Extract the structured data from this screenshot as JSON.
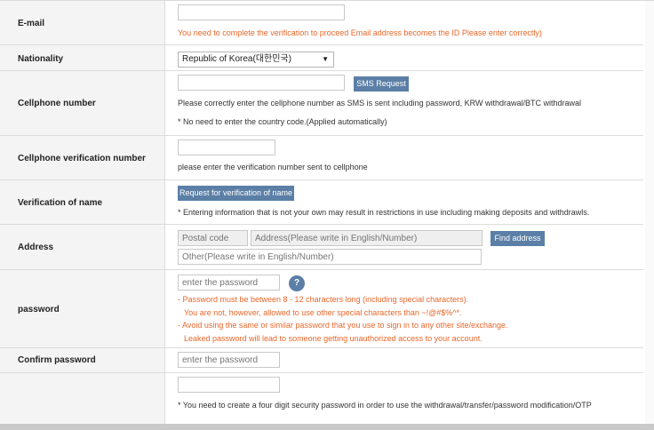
{
  "rows": {
    "email": {
      "label": "E-mail",
      "value": "",
      "hint": "You need to complete the verification to proceed Email address becomes the ID Please enter correctly)"
    },
    "nationality": {
      "label": "Nationality",
      "selected": "Republic of Korea(대한민국)"
    },
    "cellphone": {
      "label": "Cellphone number",
      "value": "",
      "button": "SMS Request",
      "hint1": "Please correctly enter the cellphone number as SMS is sent including password, KRW withdrawal/BTC withdrawal",
      "hint2": "* No need to enter the country code.(Applied automatically)"
    },
    "verification": {
      "label": "Cellphone verification number",
      "value": "",
      "hint": "please enter the verification number sent to cellphone"
    },
    "name": {
      "label": "Verification of name",
      "button": "Request for verification of name",
      "hint": "* Entering information that is not your own may result in restrictions in use including making deposits and withdrawls."
    },
    "address": {
      "label": "Address",
      "postal_placeholder": "Postal code",
      "address_placeholder": "Address(Please write in English/Number)",
      "button": "Find address",
      "other_placeholder": "Other(Please write in English/Number)"
    },
    "password": {
      "label": "password",
      "placeholder": "enter the password",
      "help": "?",
      "rule1": "- Password must be between 8 - 12 characters long (including special characters).",
      "rule2": "You are not, however, allowed to use other special characters than ~!@#$%^*.",
      "rule3": "- Avoid using the same or similar password that you use to sign in to any other site/exchange.",
      "rule4": "Leaked password will lead to someone getting unauthorized access to your account."
    },
    "confirm": {
      "label": "Confirm password",
      "placeholder": "enter the password"
    },
    "security": {
      "value": "",
      "hint": "* You need to create a four digit security password in order to use the withdrawal/transfer/password modification/OTP"
    }
  }
}
